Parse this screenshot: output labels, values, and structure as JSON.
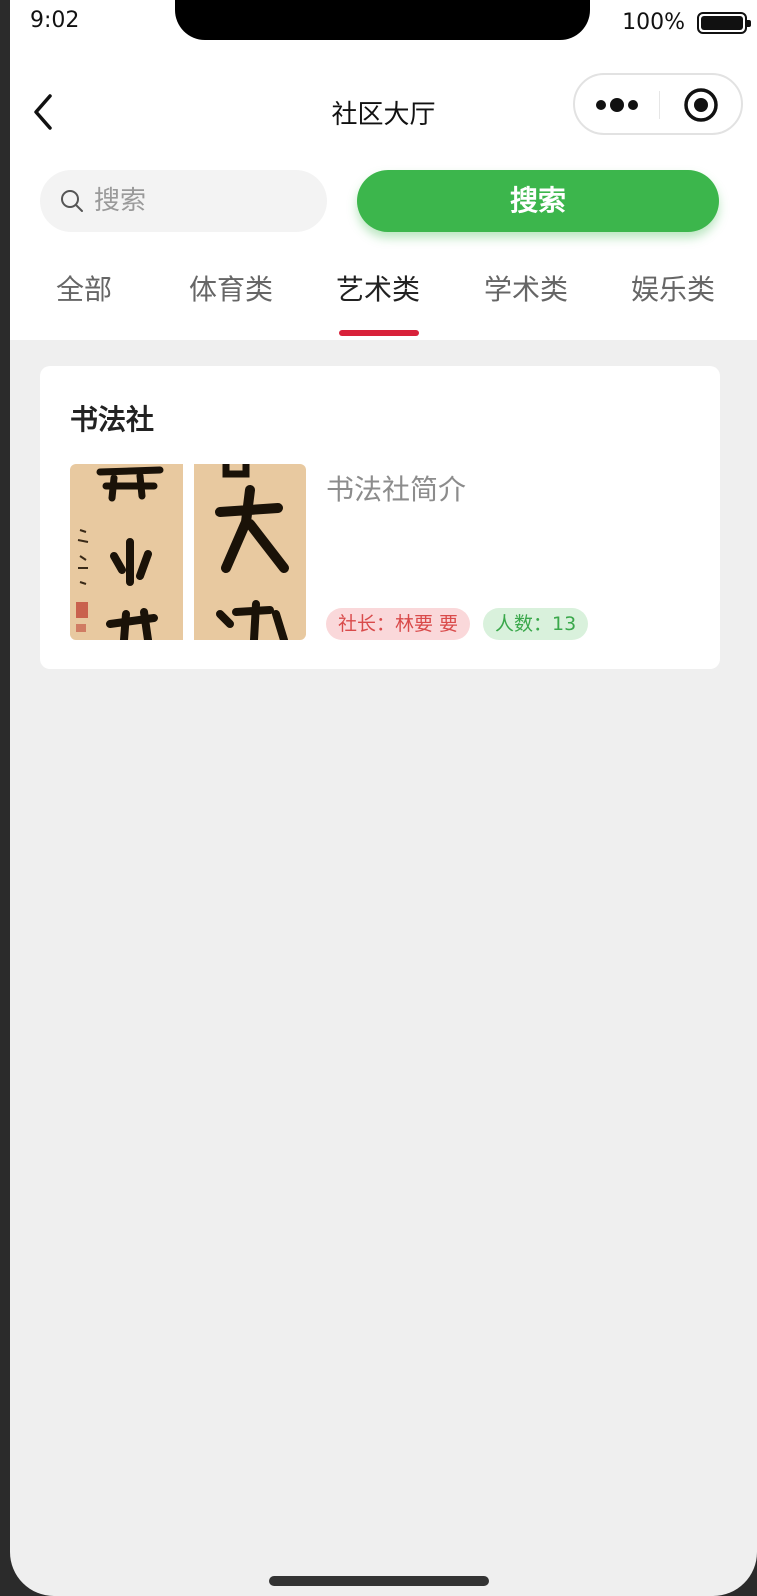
{
  "status_bar": {
    "time": "9:02",
    "battery": "100%"
  },
  "nav": {
    "title": "社区大厅"
  },
  "search": {
    "placeholder": "搜索",
    "value": "",
    "button_label": "搜索"
  },
  "tabs": [
    {
      "label": "全部",
      "active": false
    },
    {
      "label": "体育类",
      "active": false
    },
    {
      "label": "艺术类",
      "active": true
    },
    {
      "label": "学术类",
      "active": false
    },
    {
      "label": "娱乐类",
      "active": false
    }
  ],
  "clubs": [
    {
      "name": "书法社",
      "intro": "书法社简介",
      "leader_tag": "社长：林要 要",
      "count_tag": "人数：13",
      "image": "calligraphy-image"
    }
  ],
  "colors": {
    "accent_green": "#3cb64c",
    "tab_underline": "#d8213a",
    "leader_tag_bg": "#fad8da",
    "count_tag_bg": "#d9f1dc"
  }
}
